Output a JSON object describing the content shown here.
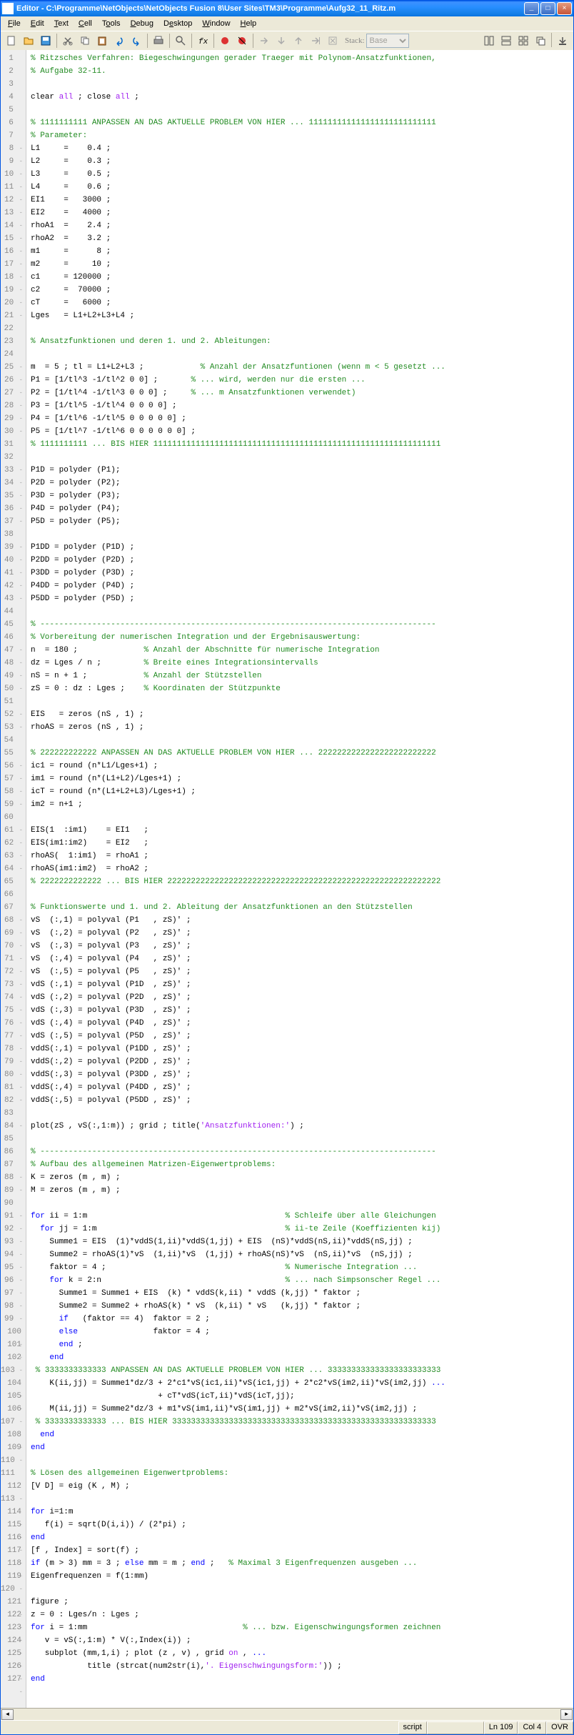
{
  "window": {
    "title": "Editor - C:\\Programme\\NetObjects\\NetObjects Fusion 8\\User Sites\\TM3\\Programme\\Aufg32_11_Ritz.m"
  },
  "menu": {
    "file": "File",
    "edit": "Edit",
    "text": "Text",
    "cell": "Cell",
    "tools": "Tools",
    "debug": "Debug",
    "desktop": "Desktop",
    "window": "Window",
    "help": "Help"
  },
  "toolbar": {
    "stack": "Stack:",
    "base": "Base"
  },
  "status": {
    "script": "script",
    "ln_label": "Ln",
    "ln": "109",
    "col_label": "Col",
    "col": "4",
    "ovr": "OVR"
  },
  "code": [
    {
      "t": "comment",
      "s": "% Ritzsches Verfahren: Biegeschwingungen gerader Traeger mit Polynom-Ansatzfunktionen,"
    },
    {
      "t": "comment",
      "s": "% Aufgabe 32-11."
    },
    {
      "t": "blank",
      "s": ""
    },
    {
      "t": "mix",
      "p": [
        [
          "text",
          "clear "
        ],
        [
          "string",
          "all"
        ],
        [
          "text",
          " ; close "
        ],
        [
          "string",
          "all"
        ],
        [
          "text",
          " ;"
        ]
      ]
    },
    {
      "t": "blank",
      "s": ""
    },
    {
      "t": "comment",
      "s": "% 1111111111 ANPASSEN AN DAS AKTUELLE PROBLEM VON HIER ... 111111111111111111111111111"
    },
    {
      "t": "comment",
      "s": "% Parameter:"
    },
    {
      "t": "text",
      "s": "L1     =    0.4 ;"
    },
    {
      "t": "text",
      "s": "L2     =    0.3 ;"
    },
    {
      "t": "text",
      "s": "L3     =    0.5 ;"
    },
    {
      "t": "text",
      "s": "L4     =    0.6 ;"
    },
    {
      "t": "text",
      "s": "EI1    =   3000 ;"
    },
    {
      "t": "text",
      "s": "EI2    =   4000 ;"
    },
    {
      "t": "text",
      "s": "rhoA1  =    2.4 ;"
    },
    {
      "t": "text",
      "s": "rhoA2  =    3.2 ;"
    },
    {
      "t": "text",
      "s": "m1     =      8 ;"
    },
    {
      "t": "text",
      "s": "m2     =     10 ;"
    },
    {
      "t": "text",
      "s": "c1     = 120000 ;"
    },
    {
      "t": "text",
      "s": "c2     =  70000 ;"
    },
    {
      "t": "text",
      "s": "cT     =   6000 ;"
    },
    {
      "t": "text",
      "s": "Lges   = L1+L2+L3+L4 ;"
    },
    {
      "t": "blank",
      "s": ""
    },
    {
      "t": "comment",
      "s": "% Ansatzfunktionen und deren 1. und 2. Ableitungen:"
    },
    {
      "t": "blank",
      "s": ""
    },
    {
      "t": "mix",
      "p": [
        [
          "text",
          "m  = 5 ; tl = L1+L2+L3 ;            "
        ],
        [
          "comment",
          "% Anzahl der Ansatzfuntionen (wenn m < 5 gesetzt ..."
        ]
      ]
    },
    {
      "t": "mix",
      "p": [
        [
          "text",
          "P1 = [1/tl^3 -1/tl^2 0 0] ;       "
        ],
        [
          "comment",
          "% ... wird, werden nur die ersten ..."
        ]
      ]
    },
    {
      "t": "mix",
      "p": [
        [
          "text",
          "P2 = [1/tl^4 -1/tl^3 0 0 0] ;     "
        ],
        [
          "comment",
          "% ... m Ansatzfunktionen verwendet)"
        ]
      ]
    },
    {
      "t": "text",
      "s": "P3 = [1/tl^5 -1/tl^4 0 0 0 0] ;"
    },
    {
      "t": "text",
      "s": "P4 = [1/tl^6 -1/tl^5 0 0 0 0 0] ;"
    },
    {
      "t": "text",
      "s": "P5 = [1/tl^7 -1/tl^6 0 0 0 0 0 0] ;"
    },
    {
      "t": "comment",
      "s": "% 1111111111 ... BIS HIER 1111111111111111111111111111111111111111111111111111111111111"
    },
    {
      "t": "blank",
      "s": ""
    },
    {
      "t": "text",
      "s": "P1D = polyder (P1);"
    },
    {
      "t": "text",
      "s": "P2D = polyder (P2);"
    },
    {
      "t": "text",
      "s": "P3D = polyder (P3);"
    },
    {
      "t": "text",
      "s": "P4D = polyder (P4);"
    },
    {
      "t": "text",
      "s": "P5D = polyder (P5);"
    },
    {
      "t": "blank",
      "s": ""
    },
    {
      "t": "text",
      "s": "P1DD = polyder (P1D) ;"
    },
    {
      "t": "text",
      "s": "P2DD = polyder (P2D) ;"
    },
    {
      "t": "text",
      "s": "P3DD = polyder (P3D) ;"
    },
    {
      "t": "text",
      "s": "P4DD = polyder (P4D) ;"
    },
    {
      "t": "text",
      "s": "P5DD = polyder (P5D) ;"
    },
    {
      "t": "blank",
      "s": ""
    },
    {
      "t": "comment",
      "s": "% ------------------------------------------------------------------------------------"
    },
    {
      "t": "comment",
      "s": "% Vorbereitung der numerischen Integration und der Ergebnisauswertung:"
    },
    {
      "t": "mix",
      "p": [
        [
          "text",
          "n  = 180 ;              "
        ],
        [
          "comment",
          "% Anzahl der Abschnitte für numerische Integration"
        ]
      ]
    },
    {
      "t": "mix",
      "p": [
        [
          "text",
          "dz = Lges / n ;         "
        ],
        [
          "comment",
          "% Breite eines Integrationsintervalls"
        ]
      ]
    },
    {
      "t": "mix",
      "p": [
        [
          "text",
          "nS = n + 1 ;            "
        ],
        [
          "comment",
          "% Anzahl der Stützstellen"
        ]
      ]
    },
    {
      "t": "mix",
      "p": [
        [
          "text",
          "zS = 0 : dz : Lges ;    "
        ],
        [
          "comment",
          "% Koordinaten der Stützpunkte"
        ]
      ]
    },
    {
      "t": "blank",
      "s": ""
    },
    {
      "t": "text",
      "s": "EIS   = zeros (nS , 1) ;"
    },
    {
      "t": "text",
      "s": "rhoAS = zeros (nS , 1) ;"
    },
    {
      "t": "blank",
      "s": ""
    },
    {
      "t": "comment",
      "s": "% 222222222222 ANPASSEN AN DAS AKTUELLE PROBLEM VON HIER ... 2222222222222222222222222"
    },
    {
      "t": "text",
      "s": "ic1 = round (n*L1/Lges+1) ;"
    },
    {
      "t": "text",
      "s": "im1 = round (n*(L1+L2)/Lges+1) ;"
    },
    {
      "t": "text",
      "s": "icT = round (n*(L1+L2+L3)/Lges+1) ;"
    },
    {
      "t": "text",
      "s": "im2 = n+1 ;"
    },
    {
      "t": "blank",
      "s": ""
    },
    {
      "t": "text",
      "s": "EIS(1  :im1)    = EI1   ;"
    },
    {
      "t": "text",
      "s": "EIS(im1:im2)    = EI2   ;"
    },
    {
      "t": "text",
      "s": "rhoAS(  1:im1)  = rhoA1 ;"
    },
    {
      "t": "text",
      "s": "rhoAS(im1:im2)  = rhoA2 ;"
    },
    {
      "t": "comment",
      "s": "% 2222222222222 ... BIS HIER 2222222222222222222222222222222222222222222222222222222222"
    },
    {
      "t": "blank",
      "s": ""
    },
    {
      "t": "comment",
      "s": "% Funktionswerte und 1. und 2. Ableitung der Ansatzfunktionen an den Stützstellen"
    },
    {
      "t": "text",
      "s": "vS  (:,1) = polyval (P1   , zS)' ;"
    },
    {
      "t": "text",
      "s": "vS  (:,2) = polyval (P2   , zS)' ;"
    },
    {
      "t": "text",
      "s": "vS  (:,3) = polyval (P3   , zS)' ;"
    },
    {
      "t": "text",
      "s": "vS  (:,4) = polyval (P4   , zS)' ;"
    },
    {
      "t": "text",
      "s": "vS  (:,5) = polyval (P5   , zS)' ;"
    },
    {
      "t": "text",
      "s": "vdS (:,1) = polyval (P1D  , zS)' ;"
    },
    {
      "t": "text",
      "s": "vdS (:,2) = polyval (P2D  , zS)' ;"
    },
    {
      "t": "text",
      "s": "vdS (:,3) = polyval (P3D  , zS)' ;"
    },
    {
      "t": "text",
      "s": "vdS (:,4) = polyval (P4D  , zS)' ;"
    },
    {
      "t": "text",
      "s": "vdS (:,5) = polyval (P5D  , zS)' ;"
    },
    {
      "t": "text",
      "s": "vddS(:,1) = polyval (P1DD , zS)' ;"
    },
    {
      "t": "text",
      "s": "vddS(:,2) = polyval (P2DD , zS)' ;"
    },
    {
      "t": "text",
      "s": "vddS(:,3) = polyval (P3DD , zS)' ;"
    },
    {
      "t": "text",
      "s": "vddS(:,4) = polyval (P4DD , zS)' ;"
    },
    {
      "t": "text",
      "s": "vddS(:,5) = polyval (P5DD , zS)' ;"
    },
    {
      "t": "blank",
      "s": ""
    },
    {
      "t": "mix",
      "p": [
        [
          "text",
          "plot(zS , vS(:,1:m)) ; grid ; title("
        ],
        [
          "string",
          "'Ansatzfunktionen:'"
        ],
        [
          "text",
          ") ;"
        ]
      ]
    },
    {
      "t": "blank",
      "s": ""
    },
    {
      "t": "comment",
      "s": "% ------------------------------------------------------------------------------------"
    },
    {
      "t": "comment",
      "s": "% Aufbau des allgemeinen Matrizen-Eigenwertproblems:"
    },
    {
      "t": "text",
      "s": "K = zeros (m , m) ;"
    },
    {
      "t": "text",
      "s": "M = zeros (m , m) ;"
    },
    {
      "t": "blank",
      "s": ""
    },
    {
      "t": "mix",
      "p": [
        [
          "keyword",
          "for"
        ],
        [
          "text",
          " ii = 1:m                                          "
        ],
        [
          "comment",
          "% Schleife über alle Gleichungen"
        ]
      ]
    },
    {
      "t": "mix",
      "p": [
        [
          "text",
          "  "
        ],
        [
          "keyword",
          "for"
        ],
        [
          "text",
          " jj = 1:m                                        "
        ],
        [
          "comment",
          "% ii-te Zeile (Koeffizienten kij)"
        ]
      ]
    },
    {
      "t": "text",
      "s": "    Summe1 = EIS  (1)*vddS(1,ii)*vddS(1,jj) + EIS  (nS)*vddS(nS,ii)*vddS(nS,jj) ;"
    },
    {
      "t": "text",
      "s": "    Summe2 = rhoAS(1)*vS  (1,ii)*vS  (1,jj) + rhoAS(nS)*vS  (nS,ii)*vS  (nS,jj) ;"
    },
    {
      "t": "mix",
      "p": [
        [
          "text",
          "    faktor = 4 ;                                      "
        ],
        [
          "comment",
          "% Numerische Integration ..."
        ]
      ]
    },
    {
      "t": "mix",
      "p": [
        [
          "text",
          "    "
        ],
        [
          "keyword",
          "for"
        ],
        [
          "text",
          " k = 2:n                                       "
        ],
        [
          "comment",
          "% ... nach Simpsonscher Regel ..."
        ]
      ]
    },
    {
      "t": "text",
      "s": "      Summe1 = Summe1 + EIS  (k) * vddS(k,ii) * vddS (k,jj) * faktor ;"
    },
    {
      "t": "text",
      "s": "      Summe2 = Summe2 + rhoAS(k) * vS  (k,ii) * vS   (k,jj) * faktor ;"
    },
    {
      "t": "mix",
      "p": [
        [
          "text",
          "      "
        ],
        [
          "keyword",
          "if"
        ],
        [
          "text",
          "   (faktor == 4)  faktor = 2 ;"
        ]
      ]
    },
    {
      "t": "mix",
      "p": [
        [
          "text",
          "      "
        ],
        [
          "keyword",
          "else"
        ],
        [
          "text",
          "                faktor = 4 ;"
        ]
      ]
    },
    {
      "t": "mix",
      "p": [
        [
          "text",
          "      "
        ],
        [
          "keyword",
          "end"
        ],
        [
          "text",
          " ;"
        ]
      ]
    },
    {
      "t": "mix",
      "p": [
        [
          "text",
          "    "
        ],
        [
          "keyword",
          "end"
        ]
      ]
    },
    {
      "t": "comment",
      "s": " % 3333333333333 ANPASSEN AN DAS AKTUELLE PROBLEM VON HIER ... 333333333333333333333333"
    },
    {
      "t": "mix",
      "p": [
        [
          "text",
          "    K(ii,jj) = Summe1*dz/3 + 2*c1*vS(ic1,ii)*vS(ic1,jj) + 2*c2*vS(im2,ii)*vS(im2,jj) "
        ],
        [
          "keyword",
          "..."
        ]
      ]
    },
    {
      "t": "text",
      "s": "                           + cT*vdS(icT,ii)*vdS(icT,jj);"
    },
    {
      "t": "text",
      "s": "    M(ii,jj) = Summe2*dz/3 + m1*vS(im1,ii)*vS(im1,jj) + m2*vS(im2,ii)*vS(im2,jj) ;"
    },
    {
      "t": "comment",
      "s": " % 3333333333333 ... BIS HIER 33333333333333333333333333333333333333333333333333333333"
    },
    {
      "t": "mix",
      "p": [
        [
          "text",
          "  "
        ],
        [
          "keyword",
          "end"
        ]
      ]
    },
    {
      "t": "keyword",
      "s": "end"
    },
    {
      "t": "blank",
      "s": ""
    },
    {
      "t": "comment",
      "s": "% Lösen des allgemeinen Eigenwertproblems:"
    },
    {
      "t": "text",
      "s": "[V D] = eig (K , M) ;"
    },
    {
      "t": "blank",
      "s": ""
    },
    {
      "t": "mix",
      "p": [
        [
          "keyword",
          "for"
        ],
        [
          "text",
          " i=1:m"
        ]
      ]
    },
    {
      "t": "text",
      "s": "   f(i) = sqrt(D(i,i)) / (2*pi) ;"
    },
    {
      "t": "keyword",
      "s": "end"
    },
    {
      "t": "text",
      "s": "[f , Index] = sort(f) ;"
    },
    {
      "t": "mix",
      "p": [
        [
          "keyword",
          "if"
        ],
        [
          "text",
          " (m > 3) mm = 3 ; "
        ],
        [
          "keyword",
          "else"
        ],
        [
          "text",
          " mm = m ; "
        ],
        [
          "keyword",
          "end"
        ],
        [
          "text",
          " ;   "
        ],
        [
          "comment",
          "% Maximal 3 Eigenfrequenzen ausgeben ..."
        ]
      ]
    },
    {
      "t": "text",
      "s": "Eigenfrequenzen = f(1:mm)"
    },
    {
      "t": "blank",
      "s": ""
    },
    {
      "t": "text",
      "s": "figure ;"
    },
    {
      "t": "text",
      "s": "z = 0 : Lges/n : Lges ;"
    },
    {
      "t": "mix",
      "p": [
        [
          "keyword",
          "for"
        ],
        [
          "text",
          " i = 1:mm                                 "
        ],
        [
          "comment",
          "% ... bzw. Eigenschwingungsformen zeichnen"
        ]
      ]
    },
    {
      "t": "text",
      "s": "   v = vS(:,1:m) * V(:,Index(i)) ;"
    },
    {
      "t": "mix",
      "p": [
        [
          "text",
          "   subplot (mm,1,i) ; plot (z , v) , grid "
        ],
        [
          "string",
          "on"
        ],
        [
          "text",
          " , "
        ],
        [
          "keyword",
          "..."
        ]
      ]
    },
    {
      "t": "mix",
      "p": [
        [
          "text",
          "            title (strcat(num2str(i),"
        ],
        [
          "string",
          "'. Eigenschwingungsform:'"
        ],
        [
          "text",
          ")) ;"
        ]
      ]
    },
    {
      "t": "keyword",
      "s": "end"
    }
  ],
  "dash_lines": [
    8,
    9,
    10,
    11,
    12,
    13,
    14,
    15,
    16,
    17,
    18,
    19,
    20,
    21,
    25,
    26,
    27,
    28,
    29,
    30,
    33,
    34,
    35,
    36,
    37,
    39,
    40,
    41,
    42,
    43,
    47,
    48,
    49,
    50,
    52,
    53,
    56,
    57,
    58,
    59,
    61,
    62,
    63,
    64,
    68,
    69,
    70,
    71,
    72,
    73,
    74,
    75,
    76,
    77,
    78,
    79,
    80,
    81,
    82,
    84,
    88,
    89,
    91,
    92,
    93,
    94,
    95,
    96,
    97,
    98,
    99,
    100,
    101,
    102,
    104,
    105,
    106,
    108,
    109,
    112,
    114,
    115,
    116,
    117,
    118,
    119,
    121,
    122,
    123,
    124,
    125,
    126,
    127
  ]
}
